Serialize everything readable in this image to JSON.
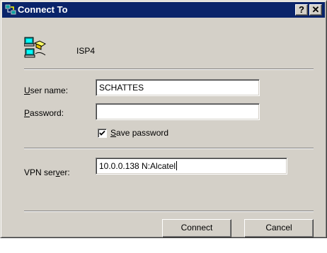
{
  "window": {
    "title": "Connect To",
    "help_label": "?",
    "close_label": "✕"
  },
  "connection": {
    "name": "ISP4"
  },
  "form": {
    "username_label_access": "U",
    "username_label_rest": "ser name:",
    "username_value": "SCHATTES",
    "password_label_access": "P",
    "password_label_rest": "assword:",
    "password_value": "",
    "save_password_access": "S",
    "save_password_rest": "ave password",
    "save_password_checked": true,
    "vpn_label_start": "VPN ser",
    "vpn_label_access": "v",
    "vpn_label_end": "er:",
    "vpn_value": "10.0.0.138  N:Alcatel"
  },
  "buttons": {
    "connect": "Connect",
    "cancel": "Cancel"
  },
  "colors": {
    "titlebar": "#0a246a",
    "face": "#d4d0c8"
  }
}
